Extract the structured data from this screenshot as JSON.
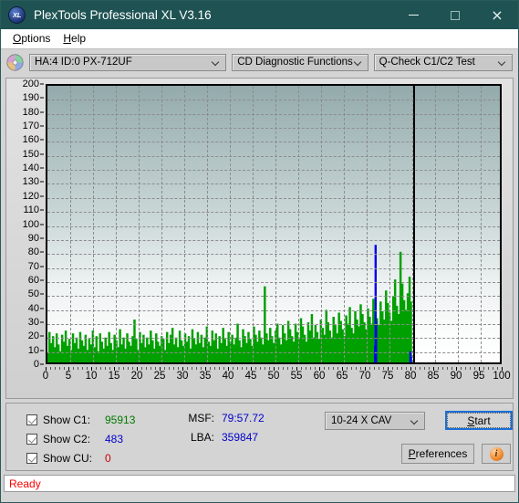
{
  "window": {
    "title": "PlexTools Professional XL V3.16",
    "app_icon": "xl-logo-icon",
    "minimize_label": "—",
    "maximize_label": "",
    "close_label": "×"
  },
  "menu": {
    "items": [
      {
        "label": "Options",
        "accel": "O"
      },
      {
        "label": "Help",
        "accel": "H"
      }
    ]
  },
  "toolbar": {
    "disc_icon": "disc-icon",
    "drive": {
      "value": "HA:4 ID:0  PX-712UF"
    },
    "function": {
      "value": "CD Diagnostic Functions"
    },
    "test": {
      "value": "Q-Check C1/C2 Test"
    }
  },
  "stats": {
    "c1": {
      "label": "Show C1:",
      "value": "95913",
      "color": "#007a00",
      "checked": true
    },
    "c2": {
      "label": "Show C2:",
      "value": "483",
      "color": "#0000cc",
      "checked": true
    },
    "cu": {
      "label": "Show CU:",
      "value": "0",
      "color": "#cc0000",
      "checked": true
    },
    "msf": {
      "label": "MSF:",
      "value": "79:57.72"
    },
    "lba": {
      "label": "LBA:",
      "value": "359847"
    },
    "speed": {
      "value": "10-24 X CAV"
    },
    "start_label": "Start",
    "start_accel": "S",
    "preferences_label": "Preferences",
    "preferences_accel": "P",
    "info_label": "i"
  },
  "statusbar": {
    "text": "Ready"
  },
  "chart_data": {
    "type": "area",
    "title": "",
    "xlabel": "",
    "ylabel": "",
    "xlim": [
      0,
      100
    ],
    "ylim": [
      0,
      200
    ],
    "xticks": [
      0,
      5,
      10,
      15,
      20,
      25,
      30,
      35,
      40,
      45,
      50,
      55,
      60,
      65,
      70,
      75,
      80,
      85,
      90,
      95,
      100
    ],
    "yticks": [
      0,
      10,
      20,
      30,
      40,
      50,
      60,
      70,
      80,
      90,
      100,
      110,
      120,
      130,
      140,
      150,
      160,
      170,
      180,
      190,
      200
    ],
    "grid": true,
    "legend": "none",
    "data_end_x": 80.2,
    "marker_line_x": 80.2,
    "colors": {
      "c1": "#00a000",
      "c2": "#0000ee",
      "cu": "#ee0000",
      "marker": "#000000"
    },
    "series": [
      {
        "name": "C1",
        "color": "#00a000",
        "x": [
          0.2,
          0.6,
          1.0,
          1.4,
          1.8,
          2.2,
          2.6,
          3.0,
          3.4,
          3.8,
          4.2,
          4.6,
          5.0,
          5.4,
          5.8,
          6.2,
          6.6,
          7.0,
          7.4,
          7.8,
          8.2,
          8.6,
          9.0,
          9.4,
          9.8,
          10.2,
          10.6,
          11.0,
          11.4,
          11.8,
          12.2,
          12.6,
          13.0,
          13.4,
          13.8,
          14.2,
          14.6,
          15.0,
          15.4,
          15.8,
          16.2,
          16.6,
          17.0,
          17.4,
          17.8,
          18.2,
          18.6,
          19.0,
          19.4,
          19.8,
          20.2,
          20.6,
          21.0,
          21.4,
          21.8,
          22.2,
          22.6,
          23.0,
          23.4,
          23.8,
          24.2,
          24.6,
          25.0,
          25.4,
          25.8,
          26.2,
          26.6,
          27.0,
          27.4,
          27.8,
          28.2,
          28.6,
          29.0,
          29.4,
          29.8,
          30.2,
          30.6,
          31.0,
          31.4,
          31.8,
          32.2,
          32.6,
          33.0,
          33.4,
          33.8,
          34.2,
          34.6,
          35.0,
          35.4,
          35.8,
          36.2,
          36.6,
          37.0,
          37.4,
          37.8,
          38.2,
          38.6,
          39.0,
          39.4,
          39.8,
          40.2,
          40.6,
          41.0,
          41.4,
          41.8,
          42.2,
          42.6,
          43.0,
          43.4,
          43.8,
          44.2,
          44.6,
          45.0,
          45.4,
          45.8,
          46.2,
          46.6,
          47.0,
          47.4,
          47.8,
          48.2,
          48.6,
          49.0,
          49.4,
          49.8,
          50.2,
          50.6,
          51.0,
          51.4,
          51.8,
          52.2,
          52.6,
          53.0,
          53.4,
          53.8,
          54.2,
          54.6,
          55.0,
          55.4,
          55.8,
          56.2,
          56.6,
          57.0,
          57.4,
          57.8,
          58.2,
          58.6,
          59.0,
          59.4,
          59.8,
          60.2,
          60.6,
          61.0,
          61.4,
          61.8,
          62.2,
          62.6,
          63.0,
          63.4,
          63.8,
          64.2,
          64.6,
          65.0,
          65.4,
          65.8,
          66.2,
          66.6,
          67.0,
          67.4,
          67.8,
          68.2,
          68.6,
          69.0,
          69.4,
          69.8,
          70.2,
          70.6,
          71.0,
          71.4,
          71.8,
          72.2,
          72.6,
          73.0,
          73.4,
          73.8,
          74.2,
          74.6,
          75.0,
          75.4,
          75.8,
          76.2,
          76.6,
          77.0,
          77.4,
          77.8,
          78.2,
          78.6,
          79.0,
          79.4,
          79.8,
          80.1
        ],
        "values": [
          22,
          14,
          19,
          11,
          21,
          13,
          8,
          20,
          15,
          23,
          12,
          17,
          9,
          21,
          14,
          18,
          10,
          22,
          16,
          12,
          20,
          9,
          17,
          13,
          23,
          11,
          19,
          8,
          21,
          15,
          10,
          18,
          12,
          22,
          14,
          9,
          20,
          16,
          11,
          24,
          13,
          18,
          10,
          21,
          15,
          12,
          19,
          31,
          17,
          9,
          22,
          14,
          20,
          11,
          18,
          13,
          23,
          16,
          10,
          21,
          15,
          12,
          19,
          17,
          9,
          22,
          14,
          20,
          25,
          13,
          18,
          11,
          23,
          16,
          12,
          21,
          15,
          19,
          10,
          24,
          17,
          13,
          22,
          14,
          20,
          11,
          18,
          26,
          15,
          12,
          23,
          16,
          21,
          10,
          19,
          14,
          25,
          17,
          12,
          22,
          15,
          20,
          13,
          18,
          28,
          16,
          11,
          24,
          19,
          14,
          22,
          17,
          12,
          26,
          20,
          15,
          23,
          18,
          13,
          55,
          21,
          16,
          25,
          19,
          14,
          23,
          28,
          18,
          13,
          27,
          21,
          16,
          30,
          24,
          19,
          15,
          28,
          22,
          17,
          32,
          26,
          20,
          15,
          29,
          23,
          35,
          18,
          27,
          22,
          17,
          31,
          25,
          20,
          38,
          29,
          23,
          18,
          33,
          27,
          21,
          36,
          30,
          24,
          19,
          34,
          28,
          40,
          25,
          21,
          37,
          31,
          26,
          42,
          35,
          29,
          24,
          39,
          33,
          28,
          46,
          38,
          32,
          27,
          44,
          37,
          31,
          52,
          43,
          36,
          30,
          48,
          60,
          41,
          35,
          80,
          57,
          45,
          38,
          50,
          62,
          44,
          37,
          55,
          47,
          40,
          58,
          50,
          43,
          66,
          56,
          48,
          41,
          62,
          70,
          53,
          45,
          68,
          58,
          50,
          43,
          64,
          56,
          49,
          72,
          60,
          52,
          45,
          66,
          57,
          50,
          74,
          61,
          53,
          46,
          68,
          59
        ]
      },
      {
        "name": "C2",
        "color": "#0000ee",
        "spikes": [
          {
            "x": 72.3,
            "value": 85
          },
          {
            "x": 72.4,
            "value": 30
          },
          {
            "x": 72.2,
            "value": 12
          },
          {
            "x": 80.0,
            "value": 8
          },
          {
            "x": 80.1,
            "value": 4
          }
        ]
      },
      {
        "name": "CU",
        "color": "#ee0000",
        "spikes": []
      }
    ]
  }
}
